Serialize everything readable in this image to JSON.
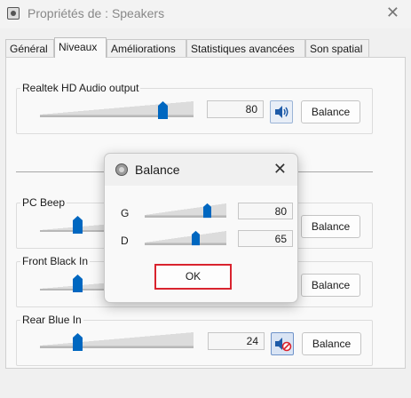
{
  "window": {
    "title": "Propriétés de : Speakers"
  },
  "tabs": [
    {
      "label": "Général"
    },
    {
      "label": "Niveaux"
    },
    {
      "label": "Améliorations"
    },
    {
      "label": "Statistiques avancées"
    },
    {
      "label": "Son spatial"
    }
  ],
  "active_tab": "Niveaux",
  "main_output": {
    "label": "Realtek HD Audio output",
    "value": "80",
    "level": 0.8,
    "balance_label": "Balance",
    "muted": false
  },
  "inputs": [
    {
      "label": "PC Beep",
      "balance_label": "Balance"
    },
    {
      "label": "Front Black In",
      "balance_label": "Balance"
    },
    {
      "label": "Rear Blue In",
      "value": "24",
      "level": 0.24,
      "balance_label": "Balance",
      "muted": true
    }
  ],
  "balance_dialog": {
    "title": "Balance",
    "channels": [
      {
        "label": "G",
        "value": "80",
        "level": 0.8
      },
      {
        "label": "D",
        "value": "65",
        "level": 0.65
      }
    ],
    "ok_label": "OK"
  },
  "colors": {
    "thumb": "#0067c0",
    "highlight": "#d9232e",
    "mute": "#d9232e"
  },
  "icons": {
    "speaker": "speaker-icon",
    "speaker_muted": "speaker-muted-icon",
    "close": "close-icon"
  }
}
